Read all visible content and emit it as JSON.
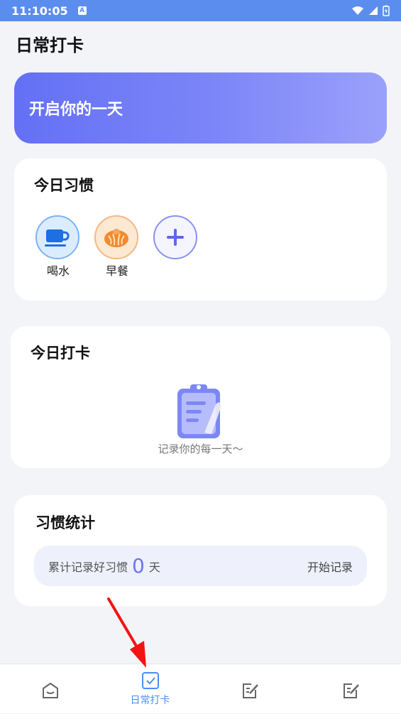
{
  "status_bar": {
    "time": "11:10:05"
  },
  "header": {
    "title": "日常打卡"
  },
  "banner": {
    "text": "开启你的一天"
  },
  "habits_card": {
    "title": "今日习惯",
    "items": [
      {
        "label": "喝水",
        "icon": "cup-icon"
      },
      {
        "label": "早餐",
        "icon": "bun-icon"
      },
      {
        "label": "",
        "icon": "plus-icon"
      }
    ]
  },
  "checkin_card": {
    "title": "今日打卡",
    "empty_text": "记录你的每一天～",
    "icon": "clipboard-icon"
  },
  "stats_card": {
    "title": "习惯统计",
    "prefix": "累计记录好习惯",
    "count": "0",
    "unit": "天",
    "action": "开始记录"
  },
  "tab_bar": {
    "tabs": [
      {
        "label": "",
        "icon": "home-icon"
      },
      {
        "label": "日常打卡",
        "icon": "check-icon",
        "active": true
      },
      {
        "label": "",
        "icon": "edit-icon"
      },
      {
        "label": "",
        "icon": "edit-icon"
      }
    ]
  },
  "colors": {
    "accent": "#6b76f0",
    "tab_active": "#4d8df2",
    "status_bar": "#5b8def"
  }
}
